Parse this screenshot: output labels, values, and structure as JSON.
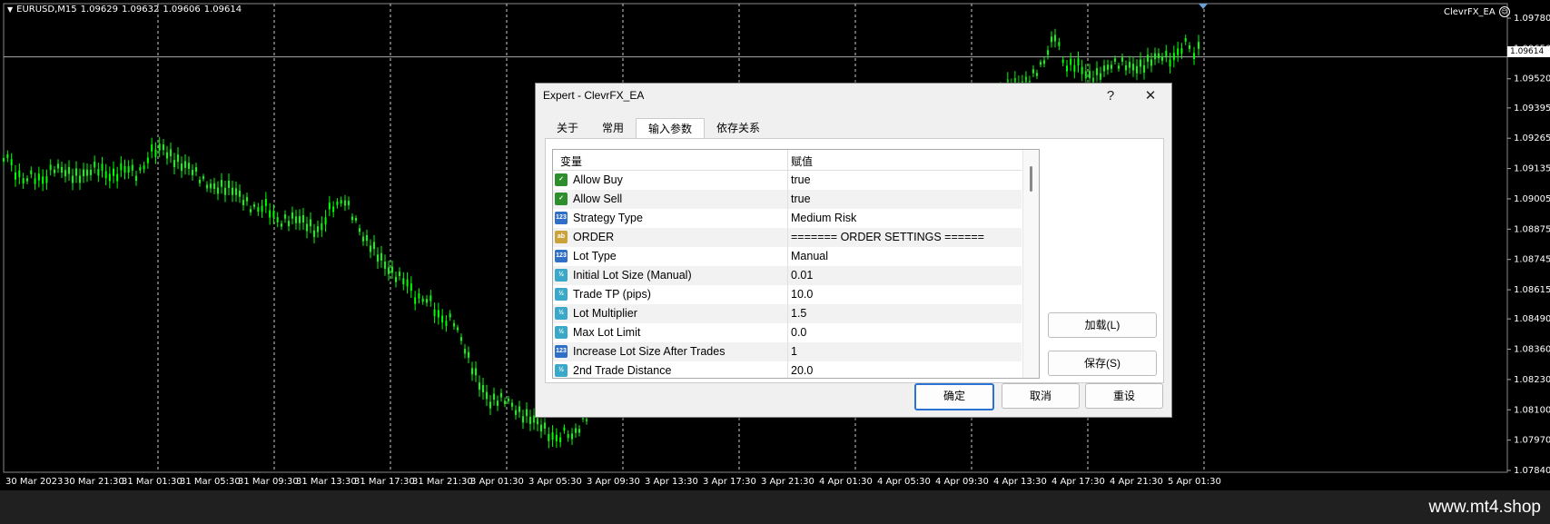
{
  "chart": {
    "symbol_info": "EURUSD,M15",
    "ohlc": [
      "1.09629",
      "1.09632",
      "1.09606",
      "1.09614"
    ],
    "ea_name": "ClevrFX_EA",
    "current_price": "1.09614",
    "price_levels": [
      "1.09780",
      "1.09650",
      "1.09520",
      "1.09395",
      "1.09265",
      "1.09135",
      "1.09005",
      "1.08875",
      "1.08745",
      "1.08615",
      "1.08490",
      "1.08360",
      "1.08230",
      "1.08100",
      "1.07970",
      "1.07840"
    ],
    "time_labels": [
      "30 Mar 2023",
      "30 Mar 21:30",
      "31 Mar 01:30",
      "31 Mar 05:30",
      "31 Mar 09:30",
      "31 Mar 13:30",
      "31 Mar 17:30",
      "31 Mar 21:30",
      "3 Apr 01:30",
      "3 Apr 05:30",
      "3 Apr 09:30",
      "3 Apr 13:30",
      "3 Apr 17:30",
      "3 Apr 21:30",
      "4 Apr 01:30",
      "4 Apr 05:30",
      "4 Apr 09:30",
      "4 Apr 13:30",
      "4 Apr 17:30",
      "4 Apr 21:30",
      "5 Apr 01:30"
    ],
    "colors": {
      "candle": "#00ff00",
      "background": "#000000",
      "grid": "#ffffff"
    }
  },
  "footer": {
    "site": "www.mt4.shop"
  },
  "dialog": {
    "title": "Expert - ClevrFX_EA",
    "help_label": "?",
    "close_label": "✕",
    "tabs": [
      {
        "label": "关于",
        "active": false
      },
      {
        "label": "常用",
        "active": false
      },
      {
        "label": "输入参数",
        "active": true
      },
      {
        "label": "依存关系",
        "active": false
      }
    ],
    "columns": {
      "variable": "变量",
      "value": "赋值"
    },
    "params": [
      {
        "type": "bool",
        "icon": "✓",
        "name": "Allow Buy",
        "value": "true"
      },
      {
        "type": "bool",
        "icon": "✓",
        "name": "Allow Sell",
        "value": "true"
      },
      {
        "type": "int",
        "icon": "123",
        "name": "Strategy Type",
        "value": "Medium Risk"
      },
      {
        "type": "str",
        "icon": "ab",
        "name": "ORDER",
        "value": "======= ORDER SETTINGS ======"
      },
      {
        "type": "int",
        "icon": "123",
        "name": "Lot Type",
        "value": "Manual"
      },
      {
        "type": "dbl",
        "icon": "½",
        "name": "Initial Lot Size (Manual)",
        "value": "0.01"
      },
      {
        "type": "dbl",
        "icon": "½",
        "name": "Trade TP (pips)",
        "value": "10.0"
      },
      {
        "type": "dbl",
        "icon": "½",
        "name": "Lot Multiplier",
        "value": "1.5"
      },
      {
        "type": "dbl",
        "icon": "½",
        "name": "Max Lot Limit",
        "value": "0.0"
      },
      {
        "type": "int",
        "icon": "123",
        "name": "Increase Lot Size After Trades",
        "value": "1"
      },
      {
        "type": "dbl",
        "icon": "½",
        "name": "2nd Trade Distance",
        "value": "20.0"
      }
    ],
    "load_label": "加载(L)",
    "save_label": "保存(S)",
    "ok_label": "确定",
    "cancel_label": "取消",
    "reset_label": "重设"
  }
}
